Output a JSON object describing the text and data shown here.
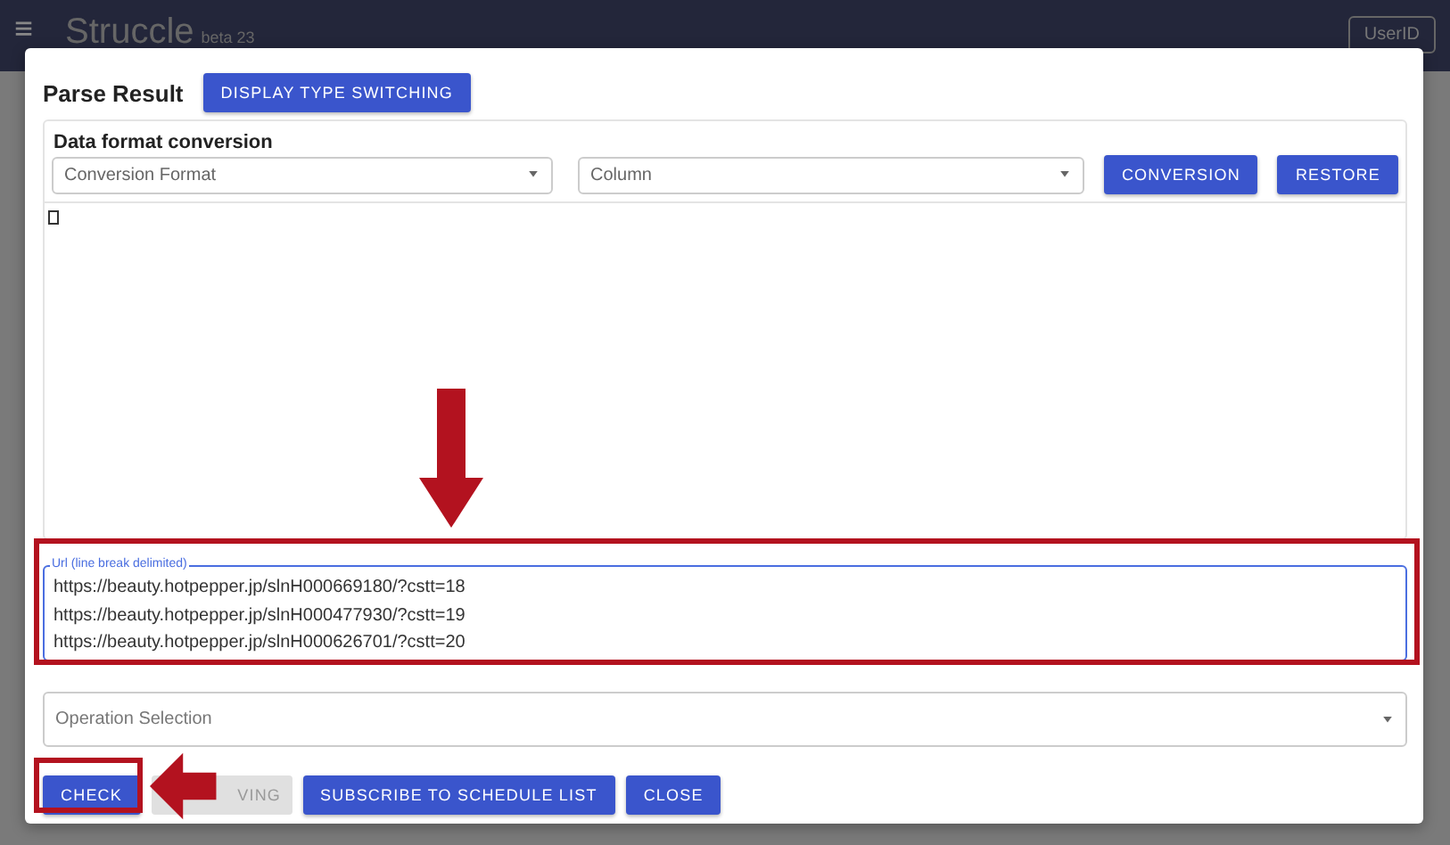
{
  "app_bar": {
    "menu_icon": "≡",
    "title": "Struccle",
    "version": "beta 23",
    "user_button": "UserID"
  },
  "dialog": {
    "title": "Parse Result",
    "switch_button": "DISPLAY TYPE SWITCHING",
    "conversion": {
      "heading": "Data format conversion",
      "format_select": {
        "placeholder": "Conversion Format"
      },
      "column_select": {
        "placeholder": "Column"
      },
      "buttons": [
        "CONVERSION",
        "RESTORE"
      ]
    },
    "url_field": {
      "label": "Url (line break delimited)",
      "lines": [
        "https://beauty.hotpepper.jp/slnH000669180/?cstt=18",
        "https://beauty.hotpepper.jp/slnH000477930/?cstt=19",
        "https://beauty.hotpepper.jp/slnH000626701/?cstt=20"
      ]
    },
    "operation_select": {
      "placeholder": "Operation Selection"
    },
    "actions": [
      {
        "label": "CHECK",
        "disabled": false
      },
      {
        "label": "VING",
        "disabled": true
      },
      {
        "label": "SUBSCRIBE TO SCHEDULE LIST",
        "disabled": false
      },
      {
        "label": "CLOSE",
        "disabled": false
      }
    ]
  }
}
